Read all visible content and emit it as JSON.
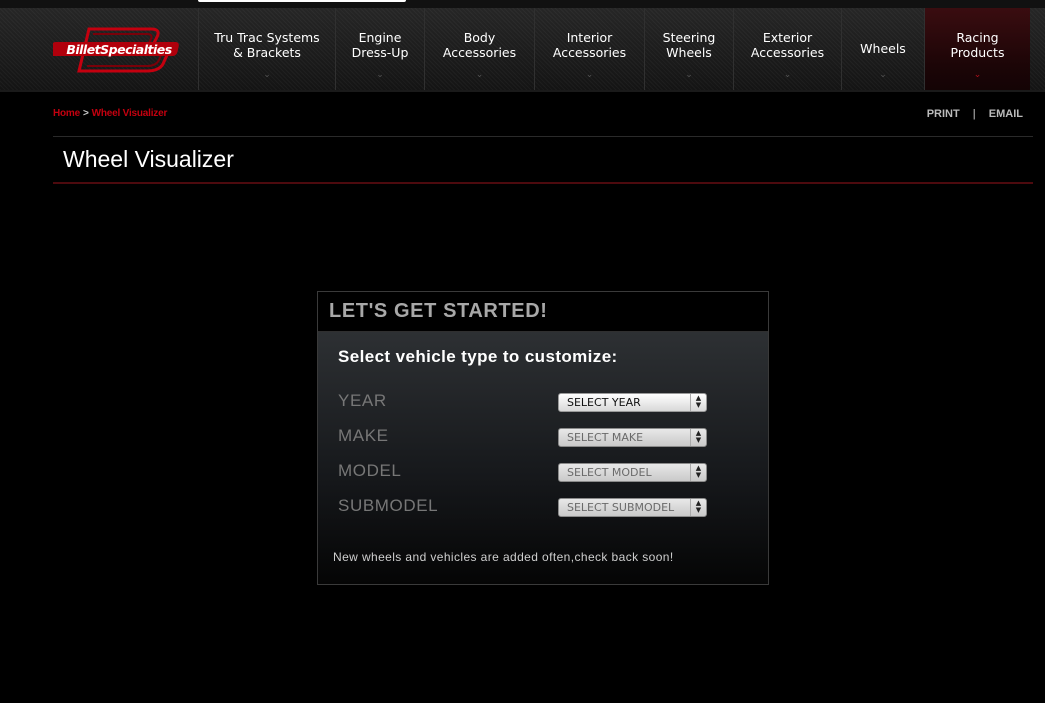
{
  "brand": {
    "logo_text": "BilletSpecialties",
    "accent": "#c4000f"
  },
  "nav": {
    "items": [
      {
        "label": "Tru Trac Systems\n& Brackets",
        "active": false
      },
      {
        "label": "Engine\nDress-Up",
        "active": false
      },
      {
        "label": "Body\nAccessories",
        "active": false
      },
      {
        "label": "Interior\nAccessories",
        "active": false
      },
      {
        "label": "Steering\nWheels",
        "active": false
      },
      {
        "label": "Exterior\nAccessories",
        "active": false
      },
      {
        "label": "Wheels",
        "active": false
      },
      {
        "label": "Racing\nProducts",
        "active": true
      }
    ],
    "chevron_icon": "chevron-down-icon"
  },
  "breadcrumb": {
    "home": "Home",
    "separator": ">",
    "current": "Wheel Visualizer"
  },
  "utilities": {
    "print": "PRINT",
    "separator": "|",
    "email": "EMAIL"
  },
  "page": {
    "title": "Wheel Visualizer"
  },
  "panel": {
    "heading": "LET'S GET STARTED!",
    "subheading": "Select vehicle type to customize:",
    "fields": [
      {
        "label": "YEAR",
        "selected": "SELECT YEAR",
        "enabled": true
      },
      {
        "label": "MAKE",
        "selected": "SELECT MAKE",
        "enabled": false
      },
      {
        "label": "MODEL",
        "selected": "SELECT MODEL",
        "enabled": false
      },
      {
        "label": "SUBMODEL",
        "selected": "SELECT SUBMODEL",
        "enabled": false
      }
    ],
    "note": "New wheels and vehicles are added often,check back soon!"
  }
}
